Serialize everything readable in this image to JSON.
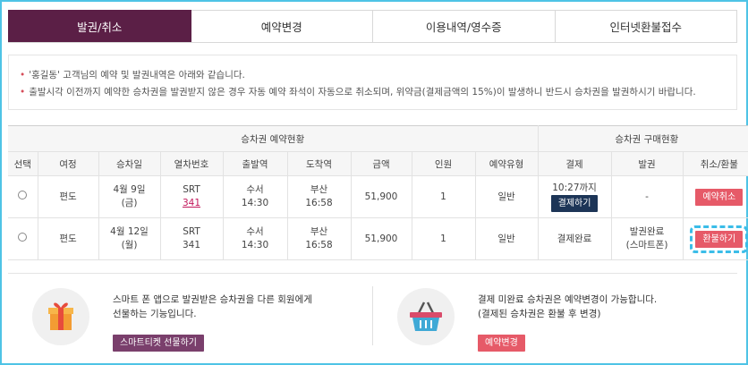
{
  "tabs": [
    "발권/취소",
    "예약변경",
    "이용내역/영수증",
    "인터넷환불접수"
  ],
  "notices": [
    "'홍길동' 고객님의 예약 및 발권내역은 아래와 같습니다.",
    "출발시각 이전까지 예약한 승차권을 발권받지 않은 경우 자동 예약 좌석이 자동으로 취소되며, 위약금(결제금액의 15%)이 발생하니 반드시 승차권을 발권하시기 바랍니다."
  ],
  "table": {
    "group_reservation": "승차권 예약현황",
    "group_purchase": "승차권 구매현황",
    "headers": [
      "선택",
      "여정",
      "승차일",
      "열차번호",
      "출발역",
      "도착역",
      "금액",
      "인원",
      "예약유형",
      "결제",
      "발권",
      "취소/환불"
    ],
    "rows": [
      {
        "trip": "편도",
        "date_line1": "4월 9일",
        "date_line2": "(금)",
        "train_type": "SRT",
        "train_no": "341",
        "dep_station": "수서",
        "dep_time": "14:30",
        "arr_station": "부산",
        "arr_time": "16:58",
        "amount": "51,900",
        "people": "1",
        "res_type": "일반",
        "pay_note": "10:27까지",
        "pay_button": "결제하기",
        "ticket": "-",
        "action": "예약취소"
      },
      {
        "trip": "편도",
        "date_line1": "4월 12일",
        "date_line2": "(월)",
        "train_type": "SRT",
        "train_no": "341",
        "dep_station": "수서",
        "dep_time": "14:30",
        "arr_station": "부산",
        "arr_time": "16:58",
        "amount": "51,900",
        "people": "1",
        "res_type": "일반",
        "pay_status": "결제완료",
        "ticket_line1": "발권완료",
        "ticket_line2": "(스마트폰)",
        "action": "환불하기"
      }
    ]
  },
  "promo_left": {
    "line1": "스마트 폰 앱으로 발권받은 승차권을 다른 회원에게",
    "line2": "선물하는 기능입니다.",
    "button": "스마트티켓 선물하기",
    "icon": "gift-icon"
  },
  "promo_right": {
    "line1": "결제 미완료 승차권은 예약변경이 가능합니다.",
    "line2": "(결제된 승차권은 환불 후 변경)",
    "button": "예약변경",
    "icon": "basket-icon"
  },
  "colors": {
    "active_tab": "#5b1f46",
    "red_button": "#e65a68",
    "navy_button": "#1d3557",
    "purple_button": "#7a3f6c",
    "focus_outline": "#3bbde8"
  }
}
